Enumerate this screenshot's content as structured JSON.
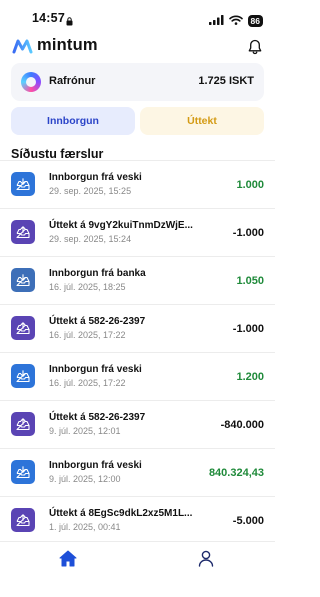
{
  "status_bar": {
    "time": "14:57",
    "battery": "86"
  },
  "header": {
    "app_name": "mintum"
  },
  "balance": {
    "label": "Rafrónur",
    "value": "1.725 ISKT"
  },
  "actions": {
    "deposit_label": "Innborgun",
    "withdraw_label": "Úttekt"
  },
  "section": {
    "title": "Síðustu færslur"
  },
  "colors": {
    "deposit_icon_bg": "#2d74d9",
    "withdraw_icon_bg": "#5a44b4",
    "bank_icon_bg": "#3d6fb8",
    "positive_amount": "#1f8a3a",
    "negative_amount": "#111111"
  },
  "transactions": [
    {
      "title": "Innborgun frá veski",
      "date": "29. sep. 2025, 15:25",
      "amount": "1.000",
      "type": "in",
      "icon": "inbox-in-icon"
    },
    {
      "title": "Úttekt á 9vgY2kuiTnmDzWjE...",
      "date": "29. sep. 2025, 15:24",
      "amount": "-1.000",
      "type": "out",
      "icon": "inbox-out-icon"
    },
    {
      "title": "Innborgun frá banka",
      "date": "16. júl. 2025, 18:25",
      "amount": "1.050",
      "type": "bank",
      "icon": "inbox-in-icon"
    },
    {
      "title": "Úttekt á 582-26-2397",
      "date": "16. júl. 2025, 17:22",
      "amount": "-1.000",
      "type": "out",
      "icon": "inbox-out-icon"
    },
    {
      "title": "Innborgun frá veski",
      "date": "16. júl. 2025, 17:22",
      "amount": "1.200",
      "type": "in",
      "icon": "inbox-in-icon"
    },
    {
      "title": "Úttekt á 582-26-2397",
      "date": "9. júl. 2025, 12:01",
      "amount": "-840.000",
      "type": "out",
      "icon": "inbox-out-icon"
    },
    {
      "title": "Innborgun frá veski",
      "date": "9. júl. 2025, 12:00",
      "amount": "840.324,43",
      "type": "in",
      "icon": "inbox-in-icon"
    },
    {
      "title": "Úttekt á 8EgSc9dkL2xz5M1L...",
      "date": "1. júl. 2025, 00:41",
      "amount": "-5.000",
      "type": "out",
      "icon": "inbox-out-icon"
    }
  ],
  "bottom_nav": {
    "active": "home"
  }
}
